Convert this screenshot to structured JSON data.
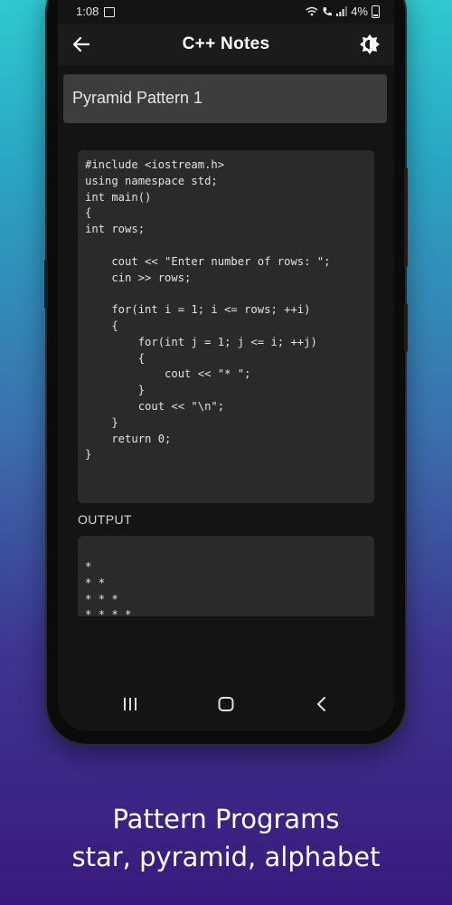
{
  "status_bar": {
    "time": "1:08",
    "battery": "4%"
  },
  "app_bar": {
    "title": "C++ Notes",
    "back_icon": "arrow-left-icon",
    "theme_icon": "brightness-icon"
  },
  "program": {
    "title": "Pyramid Pattern 1",
    "code": "#include <iostream.h>\nusing namespace std;\nint main()\n{\nint rows;\n\n    cout << \"Enter number of rows: \";\n    cin >> rows;\n\n    for(int i = 1; i <= rows; ++i)\n    {\n        for(int j = 1; j <= i; ++j)\n        {\n            cout << \"* \";\n        }\n        cout << \"\\n\";\n    }\n    return 0;\n}",
    "output_label": "OUTPUT",
    "output": "*\n* *\n* * *\n* * * *"
  },
  "nav": {
    "recent_icon": "recent-apps-icon",
    "home_icon": "home-icon",
    "back_icon": "chevron-left-icon"
  },
  "caption": {
    "line1": "Pattern Programs",
    "line2": "star, pyramid, alphabet"
  }
}
